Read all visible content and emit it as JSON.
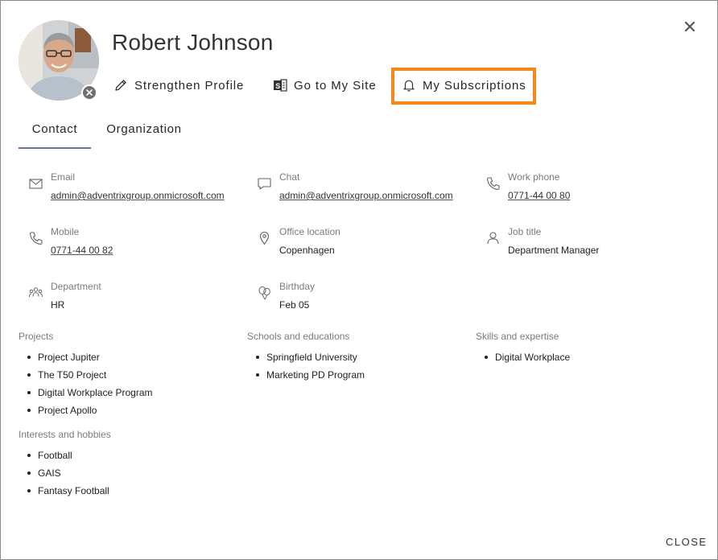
{
  "profile": {
    "name": "Robert Johnson"
  },
  "actions": {
    "strengthen": "Strengthen Profile",
    "my_site": "Go to My Site",
    "subscriptions": "My Subscriptions"
  },
  "tabs": [
    {
      "label": "Contact",
      "active": true
    },
    {
      "label": "Organization",
      "active": false
    }
  ],
  "contact": {
    "email": {
      "label": "Email",
      "value": "admin@adventrixgroup.onmicrosoft.com"
    },
    "chat": {
      "label": "Chat",
      "value": "admin@adventrixgroup.onmicrosoft.com"
    },
    "work_phone": {
      "label": "Work phone",
      "value": "0771-44 00 80"
    },
    "mobile": {
      "label": "Mobile",
      "value": "0771-44 00 82"
    },
    "office": {
      "label": "Office location",
      "value": "Copenhagen"
    },
    "job_title": {
      "label": "Job title",
      "value": "Department Manager"
    },
    "department": {
      "label": "Department",
      "value": "HR"
    },
    "birthday": {
      "label": "Birthday",
      "value": "Feb 05"
    }
  },
  "sections": {
    "projects": {
      "title": "Projects",
      "items": [
        "Project Jupiter",
        "The T50 Project",
        "Digital Workplace Program",
        "Project Apollo"
      ]
    },
    "schools": {
      "title": "Schools and educations",
      "items": [
        "Springfield University",
        "Marketing PD Program"
      ]
    },
    "skills": {
      "title": "Skills and expertise",
      "items": [
        "Digital Workplace"
      ]
    },
    "interests": {
      "title": "Interests and hobbies",
      "items": [
        "Football",
        "GAIS",
        "Fantasy Football"
      ]
    }
  },
  "footer": {
    "close_label": "CLOSE"
  },
  "colors": {
    "highlight": "#f7861c",
    "tab_underline": "#6b7795",
    "label_gray": "#7b7b7b"
  },
  "icons": {
    "close": "close-icon",
    "strengthen": "pencil-icon",
    "my_site": "office-site-icon",
    "subscriptions": "bell-icon",
    "email": "envelope-icon",
    "chat": "chat-icon",
    "phone": "phone-icon",
    "location": "location-pin-icon",
    "job": "person-icon",
    "department": "people-icon",
    "birthday": "balloons-icon"
  }
}
